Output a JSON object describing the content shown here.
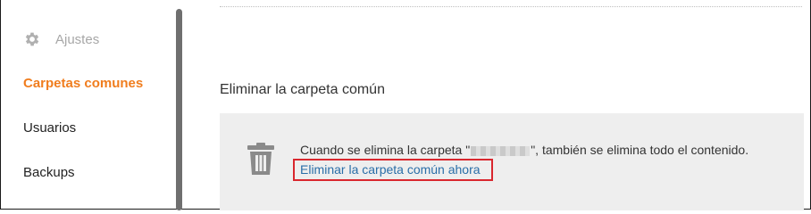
{
  "sidebar": {
    "items": [
      {
        "label": "Ajustes",
        "icon": "gear-icon",
        "state": "disabled"
      },
      {
        "label": "Carpetas comunes",
        "state": "active"
      },
      {
        "label": "Usuarios",
        "state": "normal"
      },
      {
        "label": "Backups",
        "state": "normal"
      }
    ]
  },
  "main": {
    "section_title": "Eliminar la carpeta común",
    "panel": {
      "icon": "trash-icon",
      "text_before": "Cuando se elimina la carpeta \"",
      "text_after": "\", también se elimina todo el contenido.",
      "link_label": "Eliminar la carpeta común ahora"
    }
  },
  "colors": {
    "accent": "#f07d1e",
    "link": "#2a6ea8",
    "highlight": "#d9272e",
    "panel_bg": "#eeeeee"
  }
}
